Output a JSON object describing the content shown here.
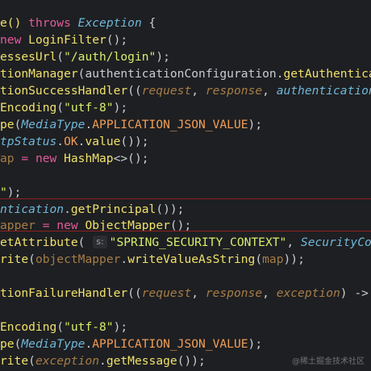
{
  "editor": {
    "colors": {
      "background": "#1e1f22",
      "keyword": "#e35b9c",
      "type": "#6fb7d9",
      "method": "#f0e16b",
      "string": "#d8ee6c",
      "constant": "#f09e56",
      "param": "#a57d47",
      "plain": "#c9ccd3",
      "comment_dim": "#8a8f98",
      "strike": "#8f2020"
    },
    "lines": [
      {
        "tokens": [
          {
            "t": "e() ",
            "c": "method"
          },
          {
            "t": "throws ",
            "c": "keyword"
          },
          {
            "t": "Exception",
            "c": "type",
            "i": true
          },
          {
            "t": " {",
            "c": "plain"
          }
        ]
      },
      {
        "tokens": [
          {
            "t": "new ",
            "c": "keyword"
          },
          {
            "t": "LoginFilter",
            "c": "method"
          },
          {
            "t": "();",
            "c": "plain"
          }
        ]
      },
      {
        "tokens": [
          {
            "t": "essesUrl",
            "c": "method"
          },
          {
            "t": "(",
            "c": "plain"
          },
          {
            "t": "\"/auth/login\"",
            "c": "string"
          },
          {
            "t": ");",
            "c": "plain"
          }
        ]
      },
      {
        "tokens": [
          {
            "t": "tionManager",
            "c": "method"
          },
          {
            "t": "(",
            "c": "plain"
          },
          {
            "t": "authenticationConfiguration",
            "c": "plain"
          },
          {
            "t": ".",
            "c": "plain"
          },
          {
            "t": "getAuthentica",
            "c": "method"
          }
        ]
      },
      {
        "tokens": [
          {
            "t": "tionSuccessHandler",
            "c": "method"
          },
          {
            "t": "((",
            "c": "plain"
          },
          {
            "t": "request",
            "c": "param",
            "i": true
          },
          {
            "t": ", ",
            "c": "plain"
          },
          {
            "t": "response",
            "c": "param",
            "i": true
          },
          {
            "t": ", ",
            "c": "plain"
          },
          {
            "t": "authentication",
            "c": "type",
            "i": true
          }
        ]
      },
      {
        "tokens": [
          {
            "t": "Encoding",
            "c": "method"
          },
          {
            "t": "(",
            "c": "plain"
          },
          {
            "t": "\"utf-8\"",
            "c": "string"
          },
          {
            "t": ");",
            "c": "plain"
          }
        ]
      },
      {
        "tokens": [
          {
            "t": "pe",
            "c": "method"
          },
          {
            "t": "(",
            "c": "plain"
          },
          {
            "t": "MediaType",
            "c": "type",
            "i": true
          },
          {
            "t": ".",
            "c": "plain"
          },
          {
            "t": "APPLICATION_JSON_VALUE",
            "c": "constant"
          },
          {
            "t": ");",
            "c": "plain"
          }
        ]
      },
      {
        "tokens": [
          {
            "t": "tpStatus",
            "c": "type",
            "i": true
          },
          {
            "t": ".",
            "c": "plain"
          },
          {
            "t": "OK",
            "c": "constant"
          },
          {
            "t": ".",
            "c": "plain"
          },
          {
            "t": "value",
            "c": "method"
          },
          {
            "t": "());",
            "c": "plain"
          }
        ]
      },
      {
        "tokens": [
          {
            "t": "ap",
            "c": "param"
          },
          {
            "t": " = ",
            "c": "keyword"
          },
          {
            "t": "new ",
            "c": "keyword"
          },
          {
            "t": "HashMap",
            "c": "method"
          },
          {
            "t": "<>();",
            "c": "plain"
          }
        ]
      },
      {
        "tokens": []
      },
      {
        "tokens": [
          {
            "t": "\"",
            "c": "string"
          },
          {
            "t": ");",
            "c": "plain"
          }
        ]
      },
      {
        "tokens": [
          {
            "t": "ntication",
            "c": "type",
            "i": true
          },
          {
            "t": ".",
            "c": "plain"
          },
          {
            "t": "getPrincipal",
            "c": "method"
          },
          {
            "t": "());",
            "c": "plain"
          }
        ]
      },
      {
        "tokens": [
          {
            "t": "apper",
            "c": "param"
          },
          {
            "t": " = ",
            "c": "keyword"
          },
          {
            "t": "new ",
            "c": "keyword"
          },
          {
            "t": "ObjectMapper",
            "c": "method"
          },
          {
            "t": "();",
            "c": "plain"
          }
        ]
      },
      {
        "hint": "s:",
        "tokens": [
          {
            "t": "etAttribute",
            "c": "method"
          },
          {
            "t": "( ",
            "c": "plain"
          },
          {
            "t": "__HINT__",
            "c": "hint"
          },
          {
            "t": "\"SPRING_SECURITY_CONTEXT\"",
            "c": "string"
          },
          {
            "t": ", ",
            "c": "plain"
          },
          {
            "t": "SecurityCon",
            "c": "type",
            "i": true
          }
        ]
      },
      {
        "tokens": [
          {
            "t": "rite",
            "c": "method"
          },
          {
            "t": "(",
            "c": "plain"
          },
          {
            "t": "objectMapper",
            "c": "param"
          },
          {
            "t": ".",
            "c": "plain"
          },
          {
            "t": "writeValueAsString",
            "c": "method"
          },
          {
            "t": "(",
            "c": "plain"
          },
          {
            "t": "map",
            "c": "param"
          },
          {
            "t": "));",
            "c": "plain"
          }
        ]
      },
      {
        "tokens": []
      },
      {
        "tokens": [
          {
            "t": "tionFailureHandler",
            "c": "method"
          },
          {
            "t": "((",
            "c": "plain"
          },
          {
            "t": "request",
            "c": "param",
            "i": true
          },
          {
            "t": ", ",
            "c": "plain"
          },
          {
            "t": "response",
            "c": "param",
            "i": true
          },
          {
            "t": ", ",
            "c": "plain"
          },
          {
            "t": "exception",
            "c": "param",
            "i": true
          },
          {
            "t": ") -> ",
            "c": "plain"
          }
        ]
      },
      {
        "tokens": []
      },
      {
        "tokens": [
          {
            "t": "Encoding",
            "c": "method"
          },
          {
            "t": "(",
            "c": "plain"
          },
          {
            "t": "\"utf-8\"",
            "c": "string"
          },
          {
            "t": ");",
            "c": "plain"
          }
        ]
      },
      {
        "tokens": [
          {
            "t": "pe",
            "c": "method"
          },
          {
            "t": "(",
            "c": "plain"
          },
          {
            "t": "MediaType",
            "c": "type",
            "i": true
          },
          {
            "t": ".",
            "c": "plain"
          },
          {
            "t": "APPLICATION_JSON_VALUE",
            "c": "constant"
          },
          {
            "t": ");",
            "c": "plain"
          }
        ]
      },
      {
        "tokens": [
          {
            "t": "rite",
            "c": "method"
          },
          {
            "t": "(",
            "c": "plain"
          },
          {
            "t": "exception",
            "c": "param",
            "i": true
          },
          {
            "t": ".",
            "c": "plain"
          },
          {
            "t": "getMessage",
            "c": "method"
          },
          {
            "t": "());",
            "c": "plain"
          }
        ]
      }
    ]
  },
  "watermark": "@稀土掘金技术社区"
}
